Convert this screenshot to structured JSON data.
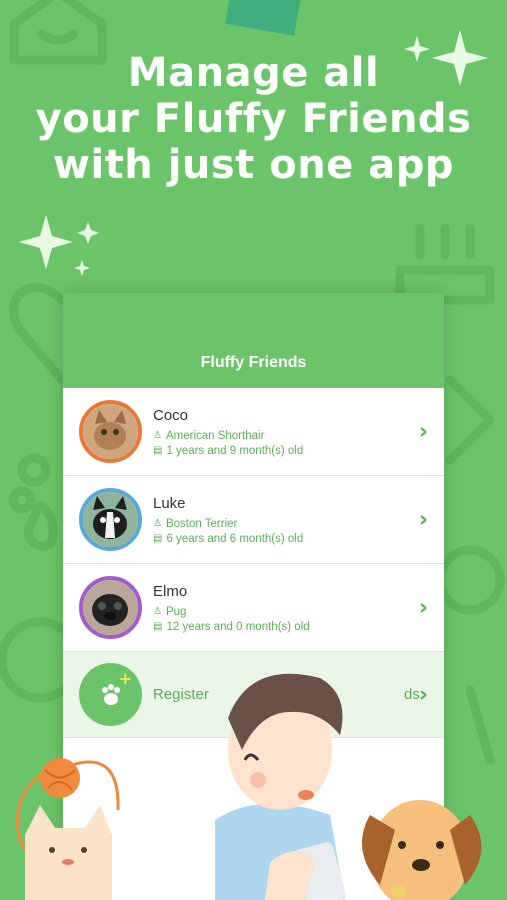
{
  "headline": {
    "line1": "Manage all",
    "line2": "your Fluffy Friends",
    "line3": "with just one app"
  },
  "app": {
    "title": "Fluffy Friends",
    "pets": [
      {
        "name": "Coco",
        "breed": "American Shorthair",
        "age": "1 years and 9 month(s) old",
        "ring_color": "#e6793a"
      },
      {
        "name": "Luke",
        "breed": "Boston Terrier",
        "age": "6 years and 6 month(s) old",
        "ring_color": "#5ba7d6"
      },
      {
        "name": "Elmo",
        "breed": "Pug",
        "age": "12 years and 0 month(s) old",
        "ring_color": "#a05cc9"
      }
    ],
    "register_label": "Register",
    "register_label_tail": "ds"
  },
  "colors": {
    "background": "#6cc46a",
    "accent": "#5aae56",
    "header": "#6cc46a"
  }
}
